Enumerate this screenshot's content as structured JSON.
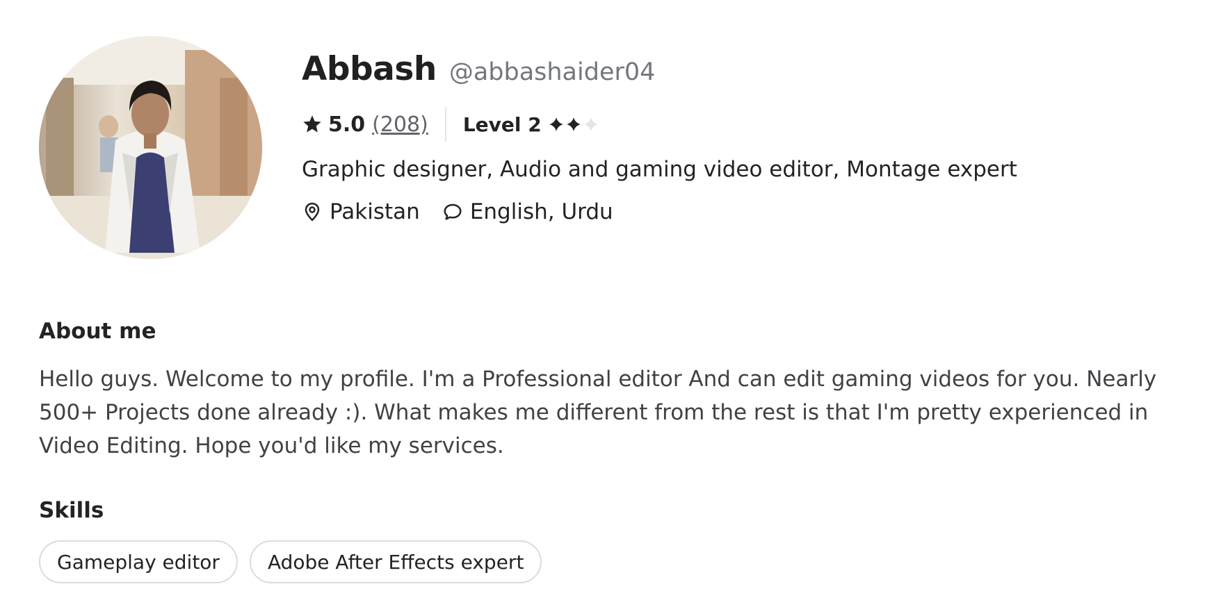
{
  "profile": {
    "display_name": "Abbash",
    "username": "@abbashaider04",
    "rating": "5.0",
    "review_count": "(208)",
    "level": "Level 2",
    "level_filled": 2,
    "level_total": 3,
    "tagline": "Graphic designer, Audio and gaming video editor, Montage expert",
    "location": "Pakistan",
    "languages": "English, Urdu",
    "icons": {
      "rating": "star-icon",
      "level": "diamond-icon",
      "location": "location-pin-icon",
      "languages": "speech-bubble-icon"
    }
  },
  "about": {
    "title": "About me",
    "text": "Hello guys. Welcome to my profile. I'm a Professional editor And can edit gaming videos for you. Nearly 500+ Projects done already :). What makes me different from the rest is that I'm pretty experienced in Video Editing. Hope you'd like my services."
  },
  "skills": {
    "title": "Skills",
    "items": [
      "Gameplay editor",
      "Adobe After Effects expert"
    ]
  },
  "colors": {
    "text_primary": "#222325",
    "text_secondary": "#74767e",
    "chip_border": "#dadbdd",
    "diamond_filled": "#222325",
    "diamond_empty": "#e4e5e7"
  }
}
